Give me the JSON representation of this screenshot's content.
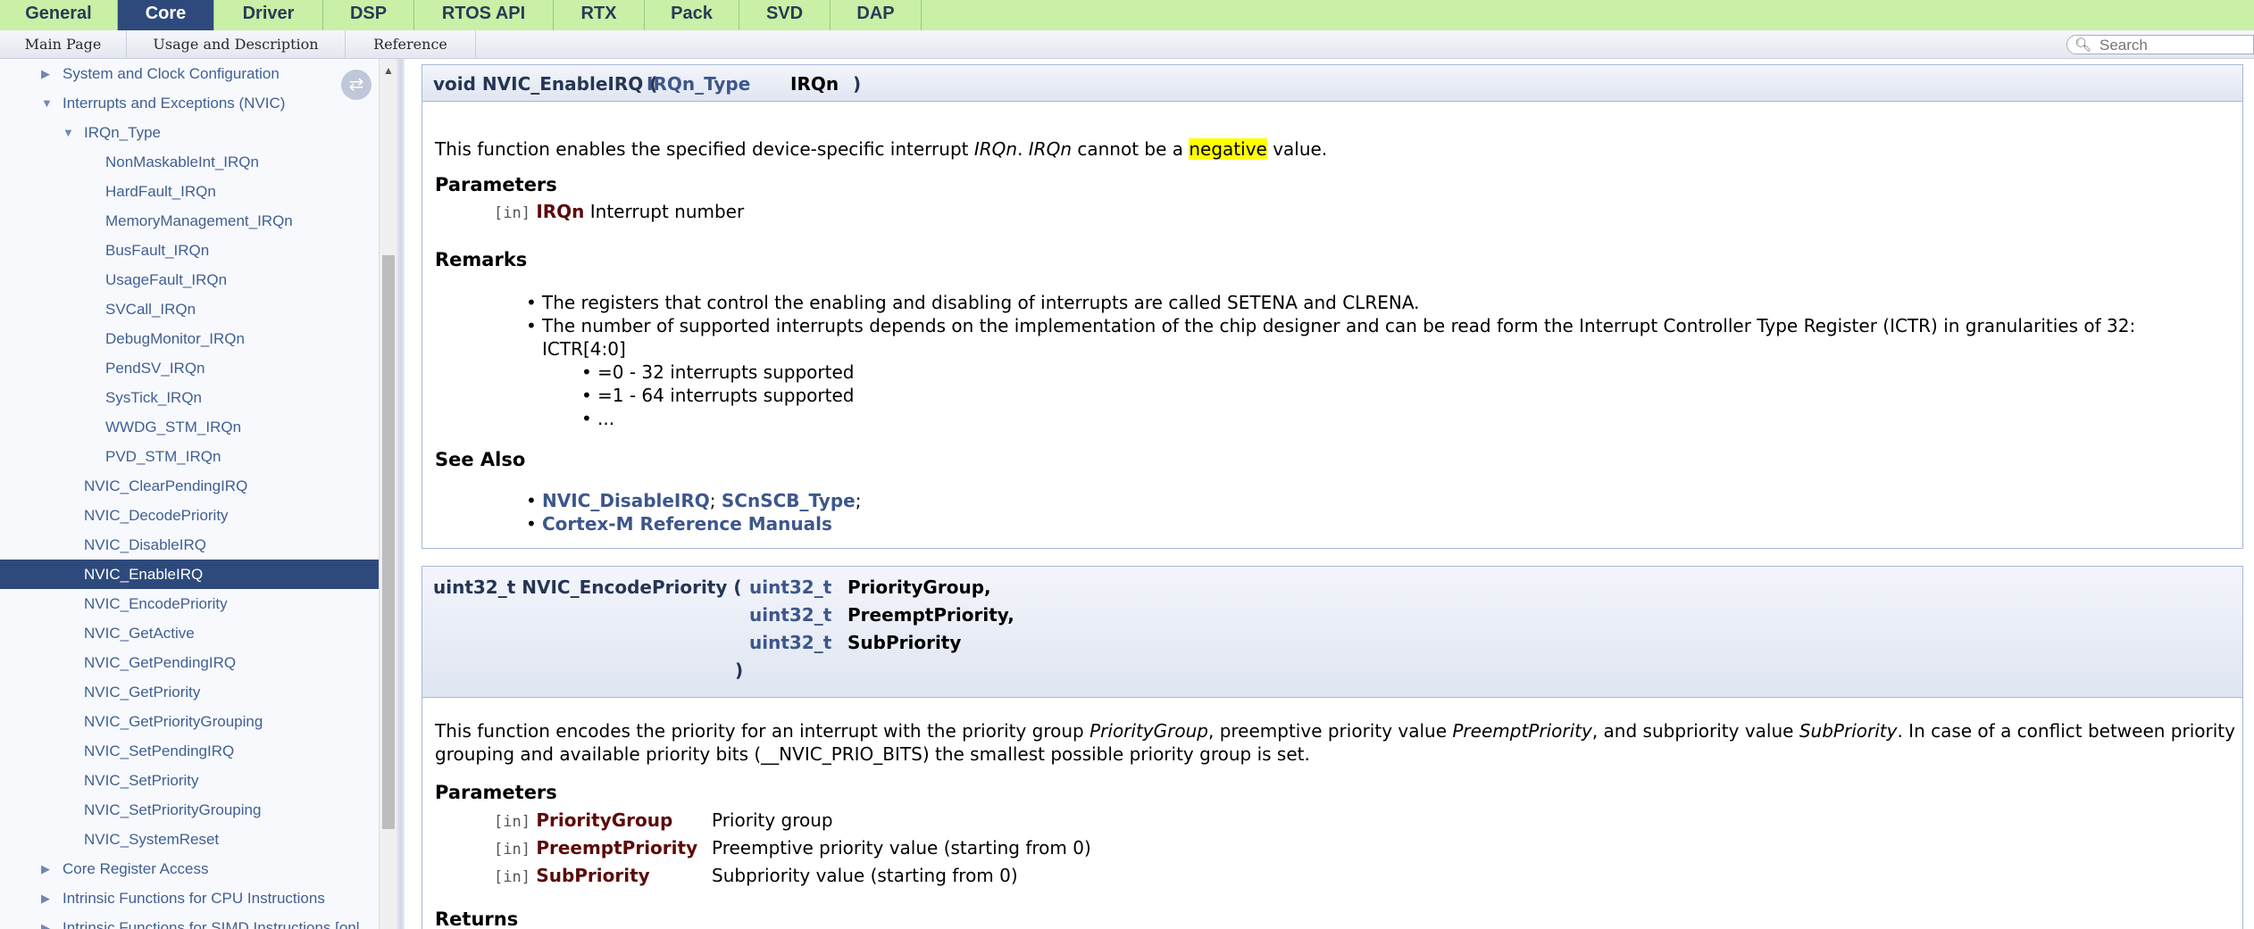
{
  "top_tabs": [
    "General",
    "Core",
    "Driver",
    "DSP",
    "RTOS API",
    "RTX",
    "Pack",
    "SVD",
    "DAP"
  ],
  "active_tab": "Core",
  "nav_links": [
    "Main Page",
    "Usage and Description",
    "Reference"
  ],
  "search": {
    "placeholder": "Search"
  },
  "sidebar": {
    "items": [
      {
        "label": "System and Clock Configuration",
        "arrow": "▶"
      },
      {
        "label": "Interrupts and Exceptions (NVIC)",
        "arrow": "▼"
      },
      {
        "label": "IRQn_Type",
        "arrow": "▼"
      },
      {
        "label": "NonMaskableInt_IRQn"
      },
      {
        "label": "HardFault_IRQn"
      },
      {
        "label": "MemoryManagement_IRQn"
      },
      {
        "label": "BusFault_IRQn"
      },
      {
        "label": "UsageFault_IRQn"
      },
      {
        "label": "SVCall_IRQn"
      },
      {
        "label": "DebugMonitor_IRQn"
      },
      {
        "label": "PendSV_IRQn"
      },
      {
        "label": "SysTick_IRQn"
      },
      {
        "label": "WWDG_STM_IRQn"
      },
      {
        "label": "PVD_STM_IRQn"
      },
      {
        "label": "NVIC_ClearPendingIRQ"
      },
      {
        "label": "NVIC_DecodePriority"
      },
      {
        "label": "NVIC_DisableIRQ"
      },
      {
        "label": "NVIC_EnableIRQ",
        "selected": true
      },
      {
        "label": "NVIC_EncodePriority"
      },
      {
        "label": "NVIC_GetActive"
      },
      {
        "label": "NVIC_GetPendingIRQ"
      },
      {
        "label": "NVIC_GetPriority"
      },
      {
        "label": "NVIC_GetPriorityGrouping"
      },
      {
        "label": "NVIC_SetPendingIRQ"
      },
      {
        "label": "NVIC_SetPriority"
      },
      {
        "label": "NVIC_SetPriorityGrouping"
      },
      {
        "label": "NVIC_SystemReset"
      },
      {
        "label": "Core Register Access",
        "arrow": "▶"
      },
      {
        "label": "Intrinsic Functions for CPU Instructions",
        "arrow": "▶"
      },
      {
        "label": "Intrinsic Functions for SIMD Instructions [onl",
        "arrow": "▶"
      }
    ]
  },
  "enable_irq": {
    "proto_prefix": "void NVIC_EnableIRQ (",
    "proto_type": "IRQn_Type",
    "proto_name": "IRQn",
    "proto_close": ")",
    "desc_a": "This function enables the specified device-specific interrupt ",
    "desc_b": "IRQn",
    "desc_c": ". ",
    "desc_d": "IRQn",
    "desc_e": " cannot be a ",
    "desc_hl": "negative",
    "desc_f": " value.",
    "params_heading": "Parameters",
    "param_in": "[in]",
    "param_name": "IRQn",
    "param_desc": "Interrupt number",
    "remarks_heading": "Remarks",
    "remark1": "The registers that control the enabling and disabling of interrupts are called SETENA and CLRENA.",
    "remark2": "The number of supported interrupts depends on the implementation of the chip designer and can be read form the Interrupt Controller Type Register (ICTR) in granularities of 32:",
    "remark2b": "ICTR[4:0]",
    "sub1": "=0 - 32 interrupts supported",
    "sub2": "=1 - 64 interrupts supported",
    "sub3": "...",
    "see_also_heading": "See Also",
    "see1a": "NVIC_DisableIRQ",
    "see1sep": "; ",
    "see1b": "SCnSCB_Type",
    "see1end": ";",
    "see2": "Cortex-M Reference Manuals"
  },
  "encode_priority": {
    "proto_prefix": "uint32_t NVIC_EncodePriority (",
    "arg1_type": "uint32_t",
    "arg1_name": "PriorityGroup,",
    "arg2_type": "uint32_t",
    "arg2_name": "PreemptPriority,",
    "arg3_type": "uint32_t",
    "arg3_name": "SubPriority",
    "proto_close": ")",
    "desc_a": "This function encodes the priority for an interrupt with the priority group ",
    "desc_b": "PriorityGroup",
    "desc_c": ", preemptive priority value ",
    "desc_d": "PreemptPriority",
    "desc_e": ", and subpriority value ",
    "desc_f": "SubPriority",
    "desc_g": ". In case of a conflict between priority",
    "desc_line2": "grouping and available priority bits (__NVIC_PRIO_BITS) the smallest possible priority group is set.",
    "params_heading": "Parameters",
    "params": [
      {
        "in": "[in]",
        "name": "PriorityGroup",
        "desc": "Priority group"
      },
      {
        "in": "[in]",
        "name": "PreemptPriority",
        "desc": "Preemptive priority value (starting from 0)"
      },
      {
        "in": "[in]",
        "name": "SubPriority",
        "desc": "Subpriority value (starting from 0)"
      }
    ],
    "returns_heading": "Returns"
  }
}
